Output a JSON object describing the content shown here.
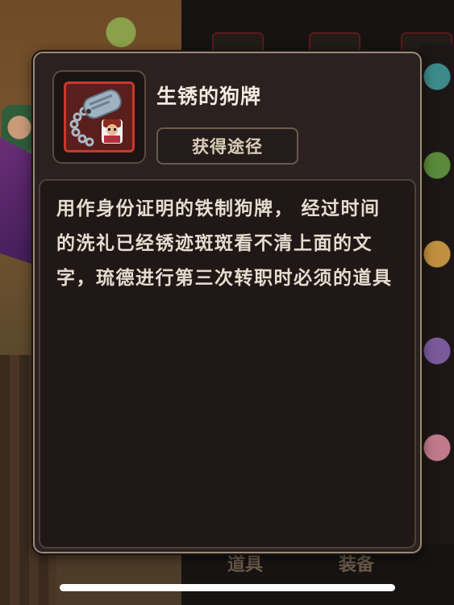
{
  "item": {
    "name": "生锈的狗牌",
    "source_button_label": "获得途径",
    "description": "用作身份证明的铁制狗牌， 经过时间的洗礼已经锈迹斑斑看不清上面的文字，琉德进行第三次转职时必须的道具",
    "icon": "rusty-dog-tag-icon"
  },
  "background": {
    "bottom_tab_left": "道具",
    "bottom_tab_right": "装备"
  },
  "colors": {
    "panel_bg": "#2b2120",
    "panel_border": "#9a8a78",
    "icon_border": "#c8382c",
    "title_text": "#f2ebe0",
    "desc_text": "#e6dccf"
  }
}
